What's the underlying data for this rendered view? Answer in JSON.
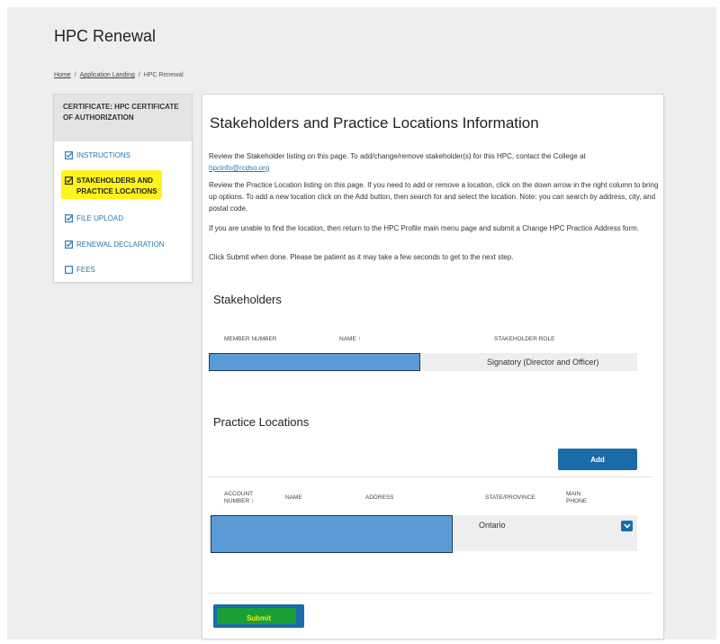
{
  "page": {
    "title": "HPC Renewal",
    "breadcrumb": [
      "Home",
      "Application Landing",
      "HPC Renewal"
    ]
  },
  "sidebar": {
    "header": "CERTIFICATE: HPC CERTIFICATE OF AUTHORIZATION",
    "items": [
      {
        "label": "INSTRUCTIONS",
        "icon": "checked-square-icon"
      },
      {
        "label": "STAKEHOLDERS AND PRACTICE LOCATIONS",
        "icon": "checked-square-icon",
        "active": true
      },
      {
        "label": "FILE UPLOAD",
        "icon": "checked-square-icon"
      },
      {
        "label": "RENEWAL DECLARATION",
        "icon": "checked-square-icon"
      },
      {
        "label": "FEES",
        "icon": "empty-square-icon"
      }
    ]
  },
  "main": {
    "title": "Stakeholders and Practice Locations Information",
    "intro": {
      "p1": "Review the Stakeholder listing on this page. To add/change/remove stakeholder(s) for this HPC, contact the College at",
      "email": "hpcinfo@rcdso.org",
      "p2": "Review the Practice Location listing on this page. If you need to add or remove a location, click on the down arrow in the right column to bring up options. To add a new location click on the Add button, then search for and select the location. Note: you can search by address, city, and postal code.",
      "p3": "If you are unable to find the location, then return to the HPC Profile main menu page and submit a Change HPC Practice Address form.",
      "p4": "Click Submit when done. Please be patient as it may take a few seconds to get to the next step."
    },
    "stakeholders": {
      "title": "Stakeholders",
      "columns": [
        "MEMBER NUMBER",
        "NAME ↑",
        "STAKEHOLDER ROLE"
      ],
      "rows": [
        {
          "member_number": "",
          "name": "",
          "role": "Signatory (Director and Officer)"
        }
      ]
    },
    "practice_locations": {
      "title": "Practice Locations",
      "add_label": "Add",
      "columns": [
        "ACCOUNT NUMBER ↑",
        "NAME",
        "ADDRESS",
        "STATE/PROVINCE",
        "MAIN PHONE"
      ],
      "rows": [
        {
          "account_number": "",
          "name": "",
          "address": "",
          "state": "Ontario",
          "phone": ""
        }
      ]
    },
    "submit_label": "Submit"
  },
  "colors": {
    "accent": "#1b6ba8",
    "link": "#2a78b0",
    "highlight": "#fff200",
    "redaction": "#5b9bd5"
  }
}
